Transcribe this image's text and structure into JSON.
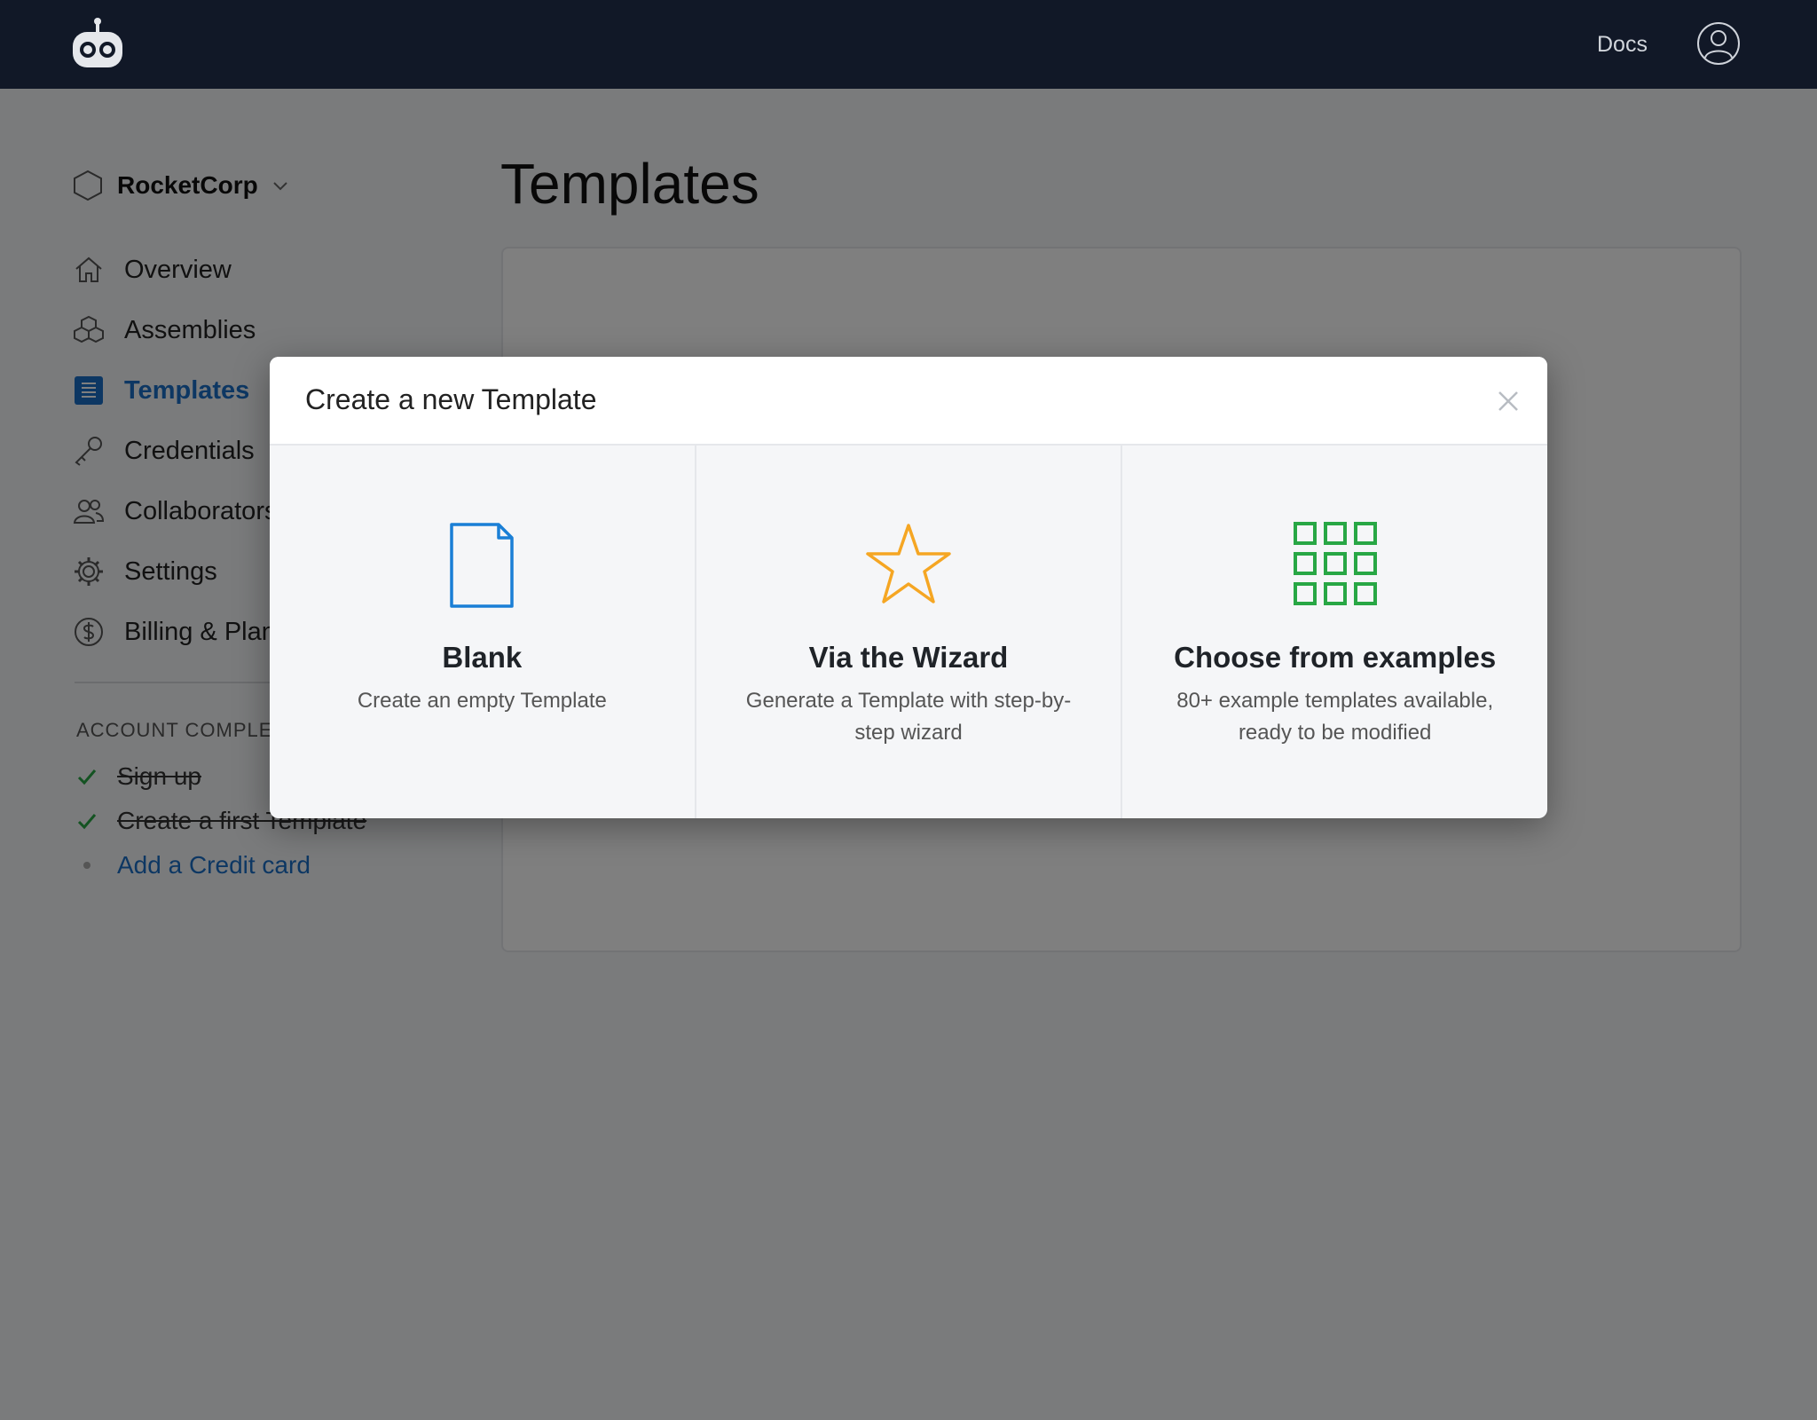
{
  "topbar": {
    "logo": "robot-logo-icon",
    "docs_label": "Docs",
    "avatar": "user-avatar-icon"
  },
  "org": {
    "name": "RocketCorp"
  },
  "sidebar": {
    "items": [
      {
        "label": "Overview",
        "icon": "home-icon",
        "active": false
      },
      {
        "label": "Assemblies",
        "icon": "cubes-icon",
        "active": false
      },
      {
        "label": "Templates",
        "icon": "document-list-icon",
        "active": true
      },
      {
        "label": "Credentials",
        "icon": "key-icon",
        "active": false
      },
      {
        "label": "Collaborators",
        "icon": "users-icon",
        "active": false
      },
      {
        "label": "Settings",
        "icon": "gear-icon",
        "active": false
      },
      {
        "label": "Billing & Plans",
        "icon": "dollar-icon",
        "active": false
      }
    ]
  },
  "checklist": {
    "title": "Account completion",
    "items": [
      {
        "label": "Sign up",
        "done": true
      },
      {
        "label": "Create a first Template",
        "done": true
      },
      {
        "label": "Add a Credit card",
        "done": false
      }
    ]
  },
  "main": {
    "title": "Templates"
  },
  "modal": {
    "title": "Create a new Template",
    "options": [
      {
        "title": "Blank",
        "desc": "Create an empty Template",
        "icon": "blank-document-icon",
        "color": "#1a7fd6"
      },
      {
        "title": "Via the Wizard",
        "desc": "Generate a Template with step-by-step wizard",
        "icon": "star-icon",
        "color": "#f5a623"
      },
      {
        "title": "Choose from examples",
        "desc": "80+ example templates available, ready to be modified",
        "icon": "grid-icon",
        "color": "#28a745"
      }
    ]
  },
  "colors": {
    "topbar": "#111827",
    "accent": "#1a6fc7",
    "check": "#28a745"
  }
}
